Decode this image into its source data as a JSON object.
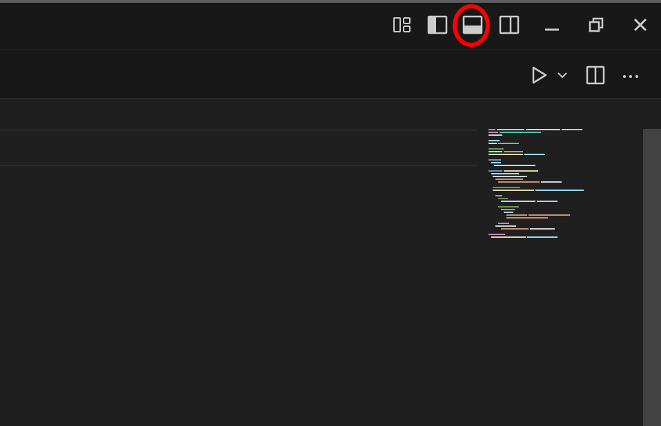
{
  "titlebar": {
    "icons": [
      "customize-layout-icon",
      "toggle-primary-sidebar-icon",
      "toggle-panel-icon",
      "toggle-secondary-sidebar-icon",
      "minimize-icon",
      "restore-icon",
      "close-icon"
    ],
    "highlighted": "toggle-panel-icon",
    "highlight_color": "#ff0000"
  },
  "editor_toolbar": {
    "icons": [
      "run-icon",
      "run-dropdown-chevron-icon",
      "split-editor-icon",
      "more-actions-icon"
    ]
  },
  "colors": {
    "titlebar_bg": "#181818",
    "editor_bg": "#1f1f1f",
    "icon_color": "#cccccc"
  }
}
